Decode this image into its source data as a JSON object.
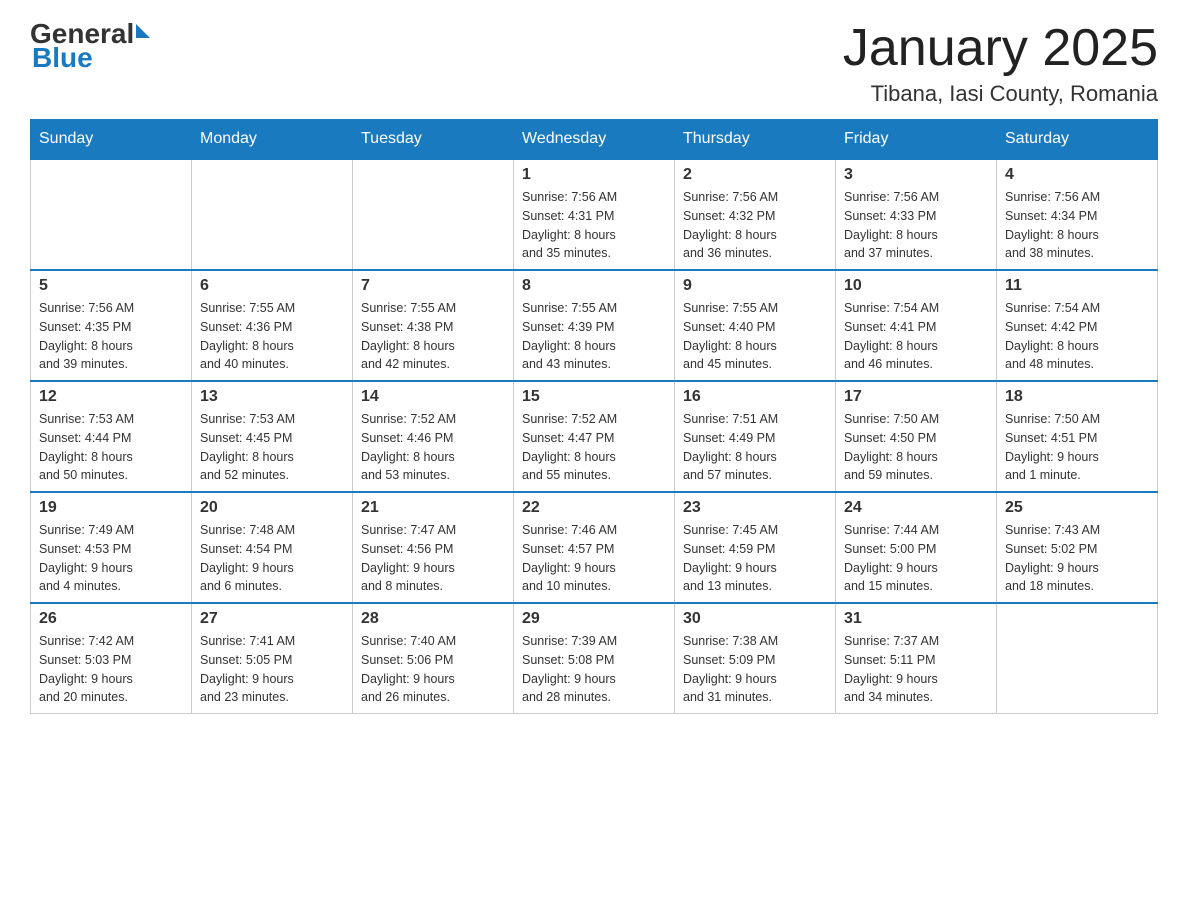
{
  "header": {
    "logo_general": "General",
    "logo_blue": "Blue",
    "month_title": "January 2025",
    "location": "Tibana, Iasi County, Romania"
  },
  "days_of_week": [
    "Sunday",
    "Monday",
    "Tuesday",
    "Wednesday",
    "Thursday",
    "Friday",
    "Saturday"
  ],
  "weeks": [
    [
      {
        "day": "",
        "info": ""
      },
      {
        "day": "",
        "info": ""
      },
      {
        "day": "",
        "info": ""
      },
      {
        "day": "1",
        "info": "Sunrise: 7:56 AM\nSunset: 4:31 PM\nDaylight: 8 hours\nand 35 minutes."
      },
      {
        "day": "2",
        "info": "Sunrise: 7:56 AM\nSunset: 4:32 PM\nDaylight: 8 hours\nand 36 minutes."
      },
      {
        "day": "3",
        "info": "Sunrise: 7:56 AM\nSunset: 4:33 PM\nDaylight: 8 hours\nand 37 minutes."
      },
      {
        "day": "4",
        "info": "Sunrise: 7:56 AM\nSunset: 4:34 PM\nDaylight: 8 hours\nand 38 minutes."
      }
    ],
    [
      {
        "day": "5",
        "info": "Sunrise: 7:56 AM\nSunset: 4:35 PM\nDaylight: 8 hours\nand 39 minutes."
      },
      {
        "day": "6",
        "info": "Sunrise: 7:55 AM\nSunset: 4:36 PM\nDaylight: 8 hours\nand 40 minutes."
      },
      {
        "day": "7",
        "info": "Sunrise: 7:55 AM\nSunset: 4:38 PM\nDaylight: 8 hours\nand 42 minutes."
      },
      {
        "day": "8",
        "info": "Sunrise: 7:55 AM\nSunset: 4:39 PM\nDaylight: 8 hours\nand 43 minutes."
      },
      {
        "day": "9",
        "info": "Sunrise: 7:55 AM\nSunset: 4:40 PM\nDaylight: 8 hours\nand 45 minutes."
      },
      {
        "day": "10",
        "info": "Sunrise: 7:54 AM\nSunset: 4:41 PM\nDaylight: 8 hours\nand 46 minutes."
      },
      {
        "day": "11",
        "info": "Sunrise: 7:54 AM\nSunset: 4:42 PM\nDaylight: 8 hours\nand 48 minutes."
      }
    ],
    [
      {
        "day": "12",
        "info": "Sunrise: 7:53 AM\nSunset: 4:44 PM\nDaylight: 8 hours\nand 50 minutes."
      },
      {
        "day": "13",
        "info": "Sunrise: 7:53 AM\nSunset: 4:45 PM\nDaylight: 8 hours\nand 52 minutes."
      },
      {
        "day": "14",
        "info": "Sunrise: 7:52 AM\nSunset: 4:46 PM\nDaylight: 8 hours\nand 53 minutes."
      },
      {
        "day": "15",
        "info": "Sunrise: 7:52 AM\nSunset: 4:47 PM\nDaylight: 8 hours\nand 55 minutes."
      },
      {
        "day": "16",
        "info": "Sunrise: 7:51 AM\nSunset: 4:49 PM\nDaylight: 8 hours\nand 57 minutes."
      },
      {
        "day": "17",
        "info": "Sunrise: 7:50 AM\nSunset: 4:50 PM\nDaylight: 8 hours\nand 59 minutes."
      },
      {
        "day": "18",
        "info": "Sunrise: 7:50 AM\nSunset: 4:51 PM\nDaylight: 9 hours\nand 1 minute."
      }
    ],
    [
      {
        "day": "19",
        "info": "Sunrise: 7:49 AM\nSunset: 4:53 PM\nDaylight: 9 hours\nand 4 minutes."
      },
      {
        "day": "20",
        "info": "Sunrise: 7:48 AM\nSunset: 4:54 PM\nDaylight: 9 hours\nand 6 minutes."
      },
      {
        "day": "21",
        "info": "Sunrise: 7:47 AM\nSunset: 4:56 PM\nDaylight: 9 hours\nand 8 minutes."
      },
      {
        "day": "22",
        "info": "Sunrise: 7:46 AM\nSunset: 4:57 PM\nDaylight: 9 hours\nand 10 minutes."
      },
      {
        "day": "23",
        "info": "Sunrise: 7:45 AM\nSunset: 4:59 PM\nDaylight: 9 hours\nand 13 minutes."
      },
      {
        "day": "24",
        "info": "Sunrise: 7:44 AM\nSunset: 5:00 PM\nDaylight: 9 hours\nand 15 minutes."
      },
      {
        "day": "25",
        "info": "Sunrise: 7:43 AM\nSunset: 5:02 PM\nDaylight: 9 hours\nand 18 minutes."
      }
    ],
    [
      {
        "day": "26",
        "info": "Sunrise: 7:42 AM\nSunset: 5:03 PM\nDaylight: 9 hours\nand 20 minutes."
      },
      {
        "day": "27",
        "info": "Sunrise: 7:41 AM\nSunset: 5:05 PM\nDaylight: 9 hours\nand 23 minutes."
      },
      {
        "day": "28",
        "info": "Sunrise: 7:40 AM\nSunset: 5:06 PM\nDaylight: 9 hours\nand 26 minutes."
      },
      {
        "day": "29",
        "info": "Sunrise: 7:39 AM\nSunset: 5:08 PM\nDaylight: 9 hours\nand 28 minutes."
      },
      {
        "day": "30",
        "info": "Sunrise: 7:38 AM\nSunset: 5:09 PM\nDaylight: 9 hours\nand 31 minutes."
      },
      {
        "day": "31",
        "info": "Sunrise: 7:37 AM\nSunset: 5:11 PM\nDaylight: 9 hours\nand 34 minutes."
      },
      {
        "day": "",
        "info": ""
      }
    ]
  ]
}
